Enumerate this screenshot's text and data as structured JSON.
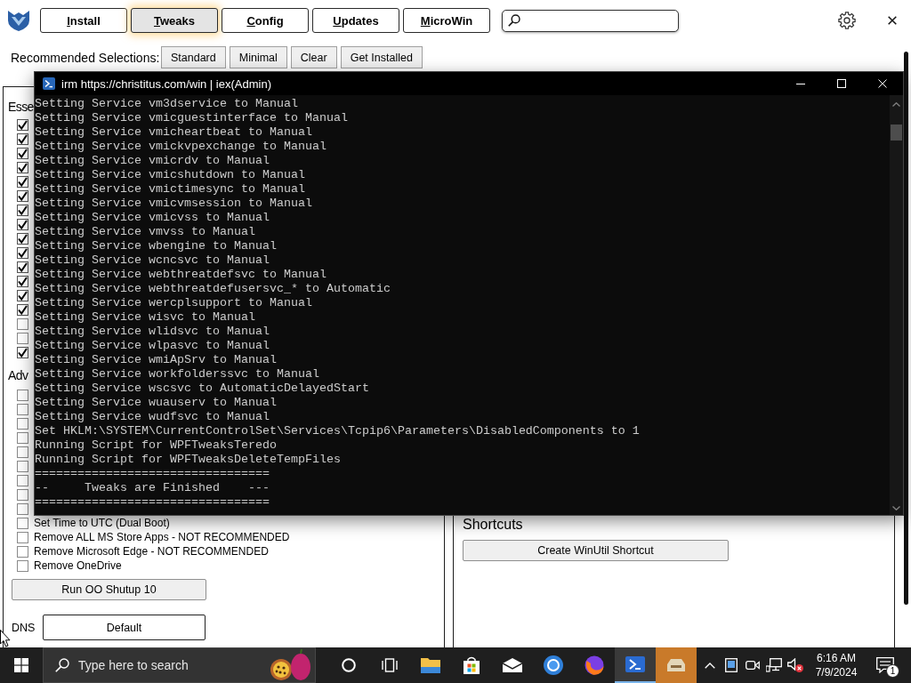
{
  "header": {
    "tabs": [
      {
        "label": "Install",
        "selected": false
      },
      {
        "label": "Tweaks",
        "selected": true
      },
      {
        "label": "Config",
        "selected": false
      },
      {
        "label": "Updates",
        "selected": false
      },
      {
        "label": "MicroWin",
        "selected": false
      }
    ]
  },
  "recommended": {
    "label": "Recommended Selections:",
    "buttons": [
      "Standard",
      "Minimal",
      "Clear",
      "Get Installed"
    ]
  },
  "tweaks_panel": {
    "sections": [
      {
        "heading": "Esse",
        "items": [
          {
            "checked": true
          },
          {
            "checked": true
          },
          {
            "checked": true
          },
          {
            "checked": true
          },
          {
            "checked": true
          },
          {
            "checked": true
          },
          {
            "checked": true
          },
          {
            "checked": true
          },
          {
            "checked": true
          },
          {
            "checked": true
          },
          {
            "checked": true
          },
          {
            "checked": true
          },
          {
            "checked": true
          },
          {
            "checked": true
          },
          {
            "checked": false
          },
          {
            "checked": false
          },
          {
            "checked": true
          }
        ]
      },
      {
        "heading": "Adv",
        "items": [
          {
            "checked": false
          },
          {
            "checked": false
          },
          {
            "checked": false
          },
          {
            "checked": false
          },
          {
            "checked": false
          },
          {
            "checked": false
          },
          {
            "checked": false
          },
          {
            "checked": false
          },
          {
            "checked": false
          },
          {
            "label": "Set Time to UTC (Dual Boot)",
            "checked": false
          },
          {
            "label": "Remove ALL MS Store Apps - NOT RECOMMENDED",
            "checked": false
          },
          {
            "label": "Remove Microsoft Edge - NOT RECOMMENDED",
            "checked": false
          },
          {
            "label": "Remove OneDrive",
            "checked": false
          }
        ]
      }
    ],
    "buttons": [
      "Run OO Shutup 10"
    ],
    "dns": {
      "label": "DNS",
      "value": "Default"
    }
  },
  "shortcuts_panel": {
    "heading": "Shortcuts",
    "buttons": [
      "Create WinUtil Shortcut"
    ]
  },
  "terminal": {
    "title": "irm https://christitus.com/win | iex(Admin)",
    "lines": [
      "Setting Service vm3dservice to Manual",
      "Setting Service vmicguestinterface to Manual",
      "Setting Service vmicheartbeat to Manual",
      "Setting Service vmickvpexchange to Manual",
      "Setting Service vmicrdv to Manual",
      "Setting Service vmicshutdown to Manual",
      "Setting Service vmictimesync to Manual",
      "Setting Service vmicvmsession to Manual",
      "Setting Service vmicvss to Manual",
      "Setting Service vmvss to Manual",
      "Setting Service wbengine to Manual",
      "Setting Service wcncsvc to Manual",
      "Setting Service webthreatdefsvc to Manual",
      "Setting Service webthreatdefusersvc_* to Automatic",
      "Setting Service wercplsupport to Manual",
      "Setting Service wisvc to Manual",
      "Setting Service wlidsvc to Manual",
      "Setting Service wlpasvc to Manual",
      "Setting Service wmiApSrv to Manual",
      "Setting Service workfolderssvc to Manual",
      "Setting Service wscsvc to AutomaticDelayedStart",
      "Setting Service wuauserv to Manual",
      "Setting Service wudfsvc to Manual",
      "Set HKLM:\\SYSTEM\\CurrentControlSet\\Services\\Tcpip6\\Parameters\\DisabledComponents to 1",
      "Running Script for WPFTweaksTeredo",
      "Running Script for WPFTweaksDeleteTempFiles",
      "=================================",
      "--     Tweaks are Finished    ---",
      "================================="
    ]
  },
  "taskbar": {
    "search": {
      "placeholder": "Type here to search"
    },
    "apps": [
      {
        "kind": "circle",
        "selected": false,
        "attention": false
      },
      {
        "kind": "task-view",
        "selected": false,
        "attention": false
      },
      {
        "kind": "folder",
        "selected": false,
        "attention": false
      },
      {
        "kind": "bag",
        "selected": false,
        "attention": false
      },
      {
        "kind": "envelope",
        "selected": false,
        "attention": false
      },
      {
        "kind": "ring",
        "selected": false,
        "attention": false
      },
      {
        "kind": "globe",
        "selected": false,
        "attention": false
      },
      {
        "kind": "terminal",
        "selected": true,
        "attention": false
      },
      {
        "kind": "tray",
        "selected": false,
        "attention": true
      }
    ],
    "clock": {
      "time": "6:16 AM",
      "date": "7/9/2024"
    },
    "notifications": {
      "count": "1"
    }
  }
}
